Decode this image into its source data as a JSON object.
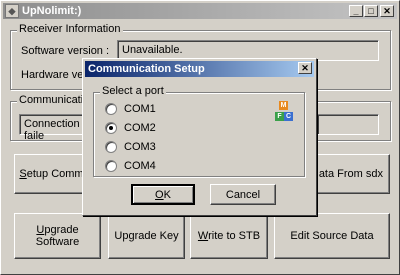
{
  "window": {
    "title": "UpNolimit:)"
  },
  "receiver_info": {
    "legend": "Receiver Information",
    "software_label": "Software version :",
    "software_value": "Unavailable.",
    "hardware_label": "Hardware versic"
  },
  "communication": {
    "legend": "Communication",
    "status": "Connection faile"
  },
  "buttons": {
    "setup_comm": "Setup Comm",
    "data_from": "ata From sdx",
    "upgrade_software": "Upgrade Software",
    "upgrade_key": "Upgrade Key",
    "write_stb": "Write to STB",
    "edit_source": "Edit Source Data"
  },
  "dialog": {
    "title": "Communication Setup",
    "group_legend": "Select a port",
    "ports": [
      "COM1",
      "COM2",
      "COM3",
      "COM4"
    ],
    "selected": "COM2",
    "ok_label": "OK",
    "cancel_label": "Cancel",
    "icon_letters": [
      "M",
      "F",
      "C"
    ]
  }
}
